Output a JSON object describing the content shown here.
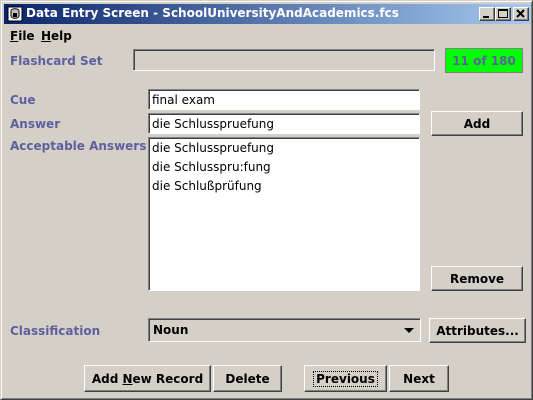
{
  "window": {
    "title": "Data Entry Screen - SchoolUniversityAndAcademics.fcs",
    "icons": [
      "app-icon",
      "minimize-icon",
      "maximize-icon",
      "close-icon"
    ]
  },
  "menu": {
    "file": {
      "underlined": "F",
      "rest": "ile"
    },
    "help": {
      "underlined": "H",
      "rest": "elp"
    }
  },
  "flashcard_set": {
    "label": "Flashcard Set",
    "value": "",
    "counter": "11 of 180"
  },
  "form": {
    "cue_label": "Cue",
    "cue_value": "final exam",
    "answer_label": "Answer",
    "answer_value": "die Schlusspruefung",
    "acceptable_label": "Acceptable Answers",
    "acceptable_answers": [
      "die Schlusspruefung",
      "die Schlusspru:fung",
      "die Schlußprüfung"
    ],
    "classification_label": "Classification",
    "classification_value": "Noun"
  },
  "buttons": {
    "add": "Add",
    "remove": "Remove",
    "attributes": "Attributes...",
    "add_new_record": {
      "before": "Add ",
      "underlined": "N",
      "after": "ew Record"
    },
    "delete": "Delete",
    "previous": "Previous",
    "next": "Next"
  },
  "colors": {
    "label": "#5f5f9f",
    "counter_bg": "#00ff00",
    "titlebar_start": "#0a246a",
    "titlebar_end": "#a6caf0",
    "window_bg": "#d4d0c8"
  }
}
